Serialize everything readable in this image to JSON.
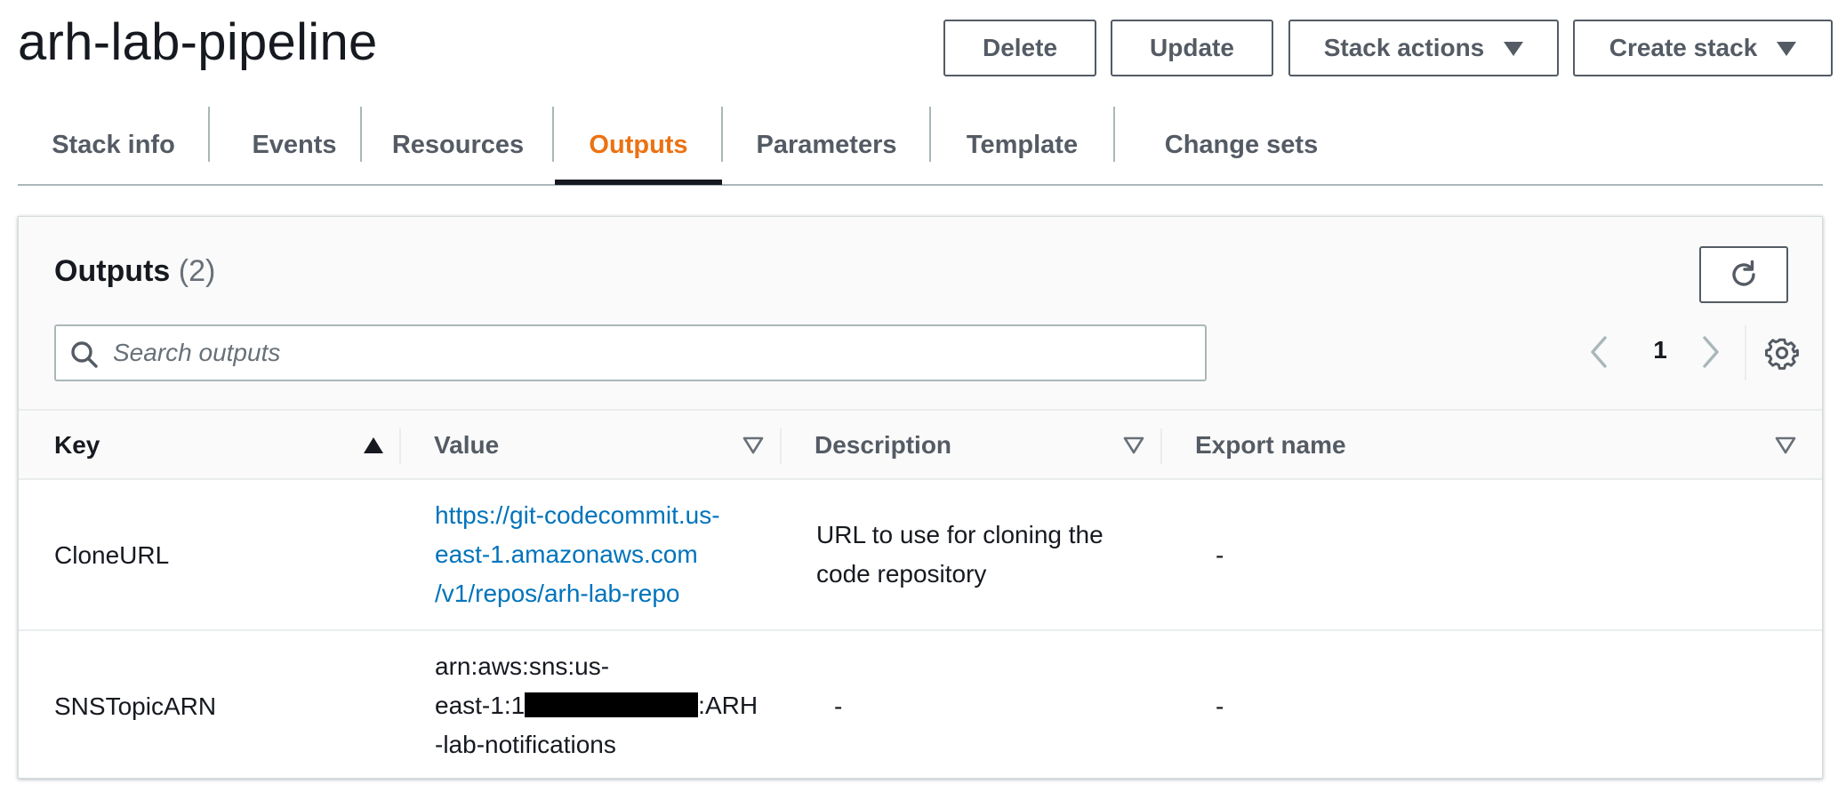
{
  "page": {
    "title": "arh-lab-pipeline"
  },
  "header_buttons": {
    "delete": "Delete",
    "update": "Update",
    "stack_actions": "Stack actions",
    "create_stack": "Create stack"
  },
  "tabs": [
    {
      "label": "Stack info"
    },
    {
      "label": "Events"
    },
    {
      "label": "Resources"
    },
    {
      "label": "Outputs",
      "active": true
    },
    {
      "label": "Parameters"
    },
    {
      "label": "Template"
    },
    {
      "label": "Change sets"
    }
  ],
  "panel": {
    "title": "Outputs",
    "count": "(2)",
    "search": {
      "placeholder": "Search outputs",
      "value": ""
    },
    "pagination": {
      "current_page": "1"
    }
  },
  "table": {
    "columns": [
      "Key",
      "Value",
      "Description",
      "Export name"
    ],
    "sort": {
      "column": "Key",
      "direction": "ascending"
    },
    "rows": [
      {
        "key": "CloneURL",
        "value_lines": [
          "https://git-codecommit.us-",
          "east-1.amazonaws.com",
          "/v1/repos/arh-lab-repo"
        ],
        "value_is_link": true,
        "description_lines": [
          "URL to use for cloning the",
          "code repository"
        ],
        "export_name": "-"
      },
      {
        "key": "SNSTopicARN",
        "value_lines": [
          "arn:aws:sns:us-",
          "east-1:1",
          ":ARH",
          "-lab-notifications"
        ],
        "value_is_link": false,
        "value_redacted": true,
        "description": "-",
        "export_name": "-"
      }
    ]
  },
  "colors": {
    "active_tab": "#ec7211",
    "link": "#0073bb",
    "text": "#16191f",
    "secondary_text": "#545b64",
    "border": "#aab7b8"
  },
  "icons": [
    "search-icon",
    "refresh-icon",
    "chevron-left-icon",
    "chevron-right-icon",
    "settings-icon",
    "sort-ascending-icon",
    "sort-descending-outline-icon",
    "caret-down-icon"
  ]
}
